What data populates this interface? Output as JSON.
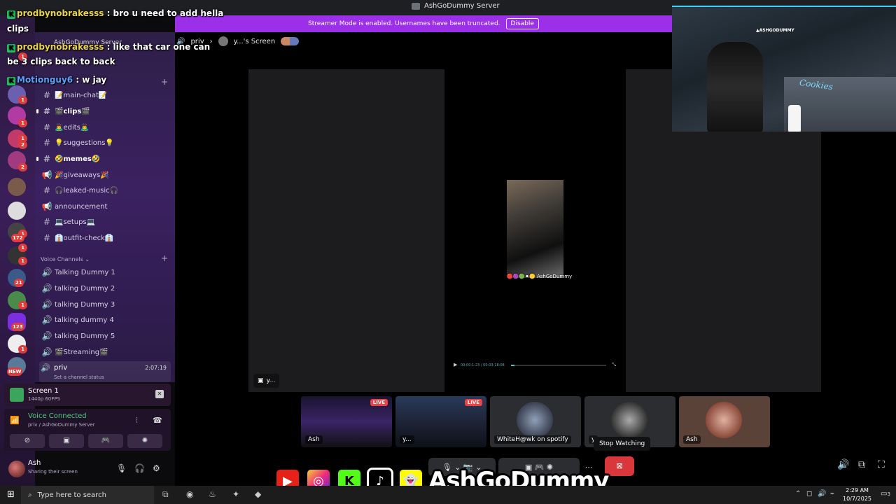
{
  "window": {
    "title": "AshGoDummy Server"
  },
  "banner": {
    "text": "Streamer Mode is enabled. Usernames have been truncated.",
    "button": "Disable"
  },
  "chat_overlay": [
    {
      "user": "prodbynobrakesss",
      "message": ": bro u need to add hella"
    },
    {
      "user": "",
      "message": "clips"
    },
    {
      "user": "prodbynobrakesss",
      "message": ": like that car one can"
    },
    {
      "user": "",
      "message": "be 3 clips back to back"
    },
    {
      "user": "Motionguy6",
      "message": ": w jay"
    }
  ],
  "server_rail": {
    "badges": [
      "1",
      "1",
      "1",
      "1",
      "2",
      "2",
      "1",
      "1",
      "172",
      "1",
      "21",
      "1",
      "123",
      "1",
      "NEW"
    ]
  },
  "sidebar": {
    "server_name": "AshGoDummy Server",
    "header_crumb": "priv",
    "text_channels": [
      {
        "icon": "#",
        "label": "📝main-chat📝"
      },
      {
        "icon": "#",
        "label": "🎬clips🎬"
      },
      {
        "icon": "#",
        "label": "🙇‍♂️edits🙇‍♂️"
      },
      {
        "icon": "#",
        "label": "💡suggestions💡"
      },
      {
        "icon": "#",
        "label": "🤣memes🤣"
      },
      {
        "icon": "📢",
        "label": "🎉giveaways🎉"
      },
      {
        "icon": "#",
        "label": "🎧leaked-music🎧"
      },
      {
        "icon": "📢",
        "label": "announcement"
      },
      {
        "icon": "#",
        "label": "💻setups💻"
      },
      {
        "icon": "#",
        "label": "👔outfit-check👔"
      }
    ],
    "voice_category": "Voice Channels",
    "voice_channels": [
      {
        "label": "Talking Dummy 1"
      },
      {
        "label": "talking Dummy 2"
      },
      {
        "label": "talking Dummy 3"
      },
      {
        "label": "talking dummy 4"
      },
      {
        "label": "talking Dummy 5"
      },
      {
        "label": "🎬Streaming🎬"
      }
    ],
    "priv": {
      "label": "priv",
      "time": "2:07:19",
      "status": "Set a channel status"
    }
  },
  "screen_panel": {
    "title": "Screen 1",
    "sub": "1440p 60FPS"
  },
  "voice_panel": {
    "title": "Voice Connected",
    "sub": "priv / AshGoDummy Server"
  },
  "user_panel": {
    "name": "Ash",
    "status": "Sharing their screen"
  },
  "main": {
    "crumb_channel": "priv",
    "crumb_stream": "y...'s Screen",
    "stage_label": "y...",
    "clip_label": "AshGoDummy",
    "seek_time": "00:00:1:23 / 00:03:18:08",
    "seek_progress": 0.04
  },
  "tiles": [
    {
      "name": "Ash",
      "live": "LIVE"
    },
    {
      "name": "y...",
      "live": "LIVE"
    },
    {
      "name": "WhiteH@wk on spotify",
      "live": ""
    },
    {
      "name": "y",
      "live": ""
    },
    {
      "name": "Ash",
      "live": ""
    }
  ],
  "tooltip": "Stop Watching",
  "brand": {
    "text": "AshGoDummy"
  },
  "taskbar": {
    "search": "Type here to search",
    "time": "2:29 AM",
    "date": "10/7/2025",
    "notif": "3"
  }
}
